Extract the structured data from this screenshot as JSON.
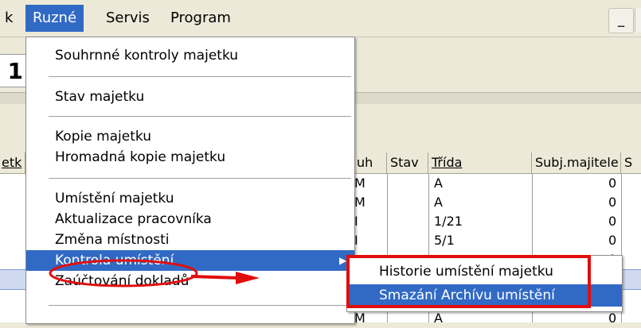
{
  "menubar": {
    "left_fragment": "k",
    "items": [
      {
        "label": "Ruzné",
        "mnemonic": "u"
      },
      {
        "label": "Servis",
        "mnemonic": "S"
      },
      {
        "label": "Program",
        "mnemonic": "g"
      }
    ],
    "minimize_label": "_"
  },
  "background": {
    "doc_tab": "1",
    "columns": [
      "etk",
      "uh",
      "Stav",
      "Třída",
      "Subj.majitele",
      "S"
    ],
    "rows": [
      [
        "M",
        "",
        "A",
        "0"
      ],
      [
        "M",
        "",
        "A",
        "0"
      ],
      [
        "I",
        "",
        "1/21",
        "0"
      ],
      [
        "I",
        "",
        "5/1",
        "0"
      ],
      [
        "",
        "",
        "",
        "0"
      ],
      [
        "",
        "",
        "",
        ""
      ],
      [
        "M",
        "",
        "A",
        "0"
      ]
    ]
  },
  "menu": {
    "items": [
      {
        "label": "Souhrnné kontroly majetku",
        "mnemonic": "n"
      },
      {
        "label": "Stav majetku",
        "mnemonic": "S"
      },
      {
        "label": "Kopie majetku",
        "mnemonic": "o"
      },
      {
        "label": "Hromadná kopie majetku",
        "mnemonic": "r"
      },
      {
        "label": "Umístění majetku",
        "mnemonic": "U"
      },
      {
        "label": "Aktualizace pracovníka",
        "mnemonic": "A"
      },
      {
        "label": "Změna místnosti",
        "mnemonic": ""
      },
      {
        "label": "Kontrola umístění",
        "mnemonic": "m"
      },
      {
        "label": "Zaúčtování dokladů",
        "mnemonic": "Z"
      }
    ]
  },
  "submenu": {
    "items": [
      {
        "label": "Historie umístění majetku",
        "mnemonic": "H"
      },
      {
        "label": "Smazání Archívu umístění",
        "mnemonic": "A"
      }
    ]
  },
  "colors": {
    "highlight": "#316ac5",
    "annotation": "#e10d0d",
    "chrome": "#ece9d8"
  }
}
